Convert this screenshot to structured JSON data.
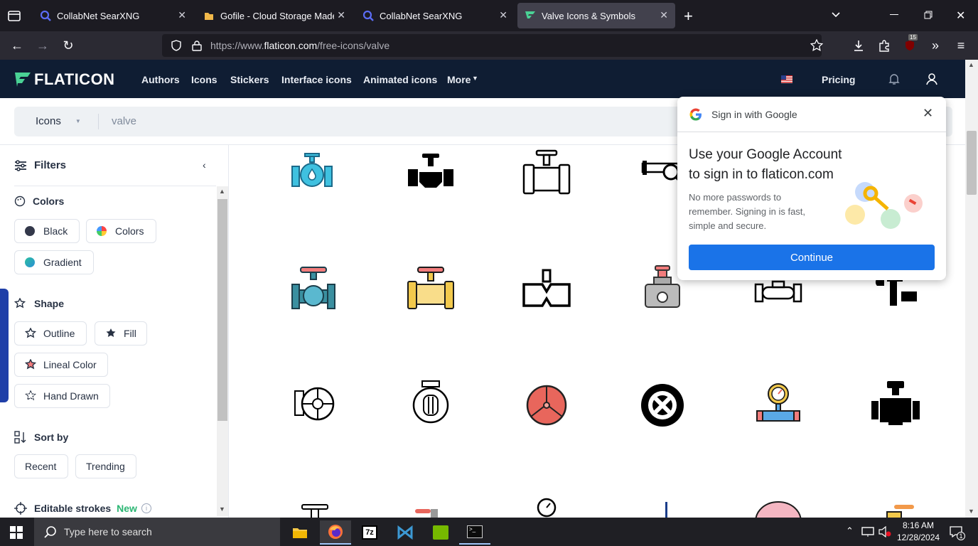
{
  "browser": {
    "tabs": [
      {
        "title": "CollabNet SearXNG",
        "icon": "search-icon"
      },
      {
        "title": "Gofile - Cloud Storage Made Si",
        "icon": "folder-icon"
      },
      {
        "title": "CollabNet SearXNG",
        "icon": "search-icon"
      },
      {
        "title": "Valve Icons & Symbols",
        "icon": "flaticon-icon"
      }
    ],
    "url": "https://www.flaticon.com/free-icons/valve",
    "url_prefix": "https://www.",
    "url_host": "flaticon.com",
    "url_path": "/free-icons/valve",
    "badge_count": "15"
  },
  "site": {
    "logo": "FLATICON",
    "nav": [
      "Authors",
      "Icons",
      "Stickers",
      "Interface icons",
      "Animated icons",
      "More"
    ],
    "pricing": "Pricing",
    "accent": "#0f1d33",
    "brand_green": "#4ad295"
  },
  "search": {
    "type": "Icons",
    "query": "valve"
  },
  "filters": {
    "title": "Filters",
    "colors_title": "Colors",
    "colors": [
      "Black",
      "Colors",
      "Gradient"
    ],
    "shape_title": "Shape",
    "shapes": [
      "Outline",
      "Fill",
      "Lineal Color",
      "Hand Drawn"
    ],
    "sort_title": "Sort by",
    "sorts": [
      "Recent",
      "Trending"
    ],
    "editable_title": "Editable strokes",
    "editable_badge": "New"
  },
  "google_popup": {
    "header": "Sign in with Google",
    "title_line1": "Use your Google Account",
    "title_line2": "to sign in to flaticon.com",
    "body_line1": "No more passwords to",
    "body_line2": "remember. Signing in is fast,",
    "body_line3": "simple and secure.",
    "button": "Continue"
  },
  "taskbar": {
    "search_placeholder": "Type here to search",
    "time": "8:16 AM",
    "date": "12/28/2024",
    "notification_count": "1"
  }
}
